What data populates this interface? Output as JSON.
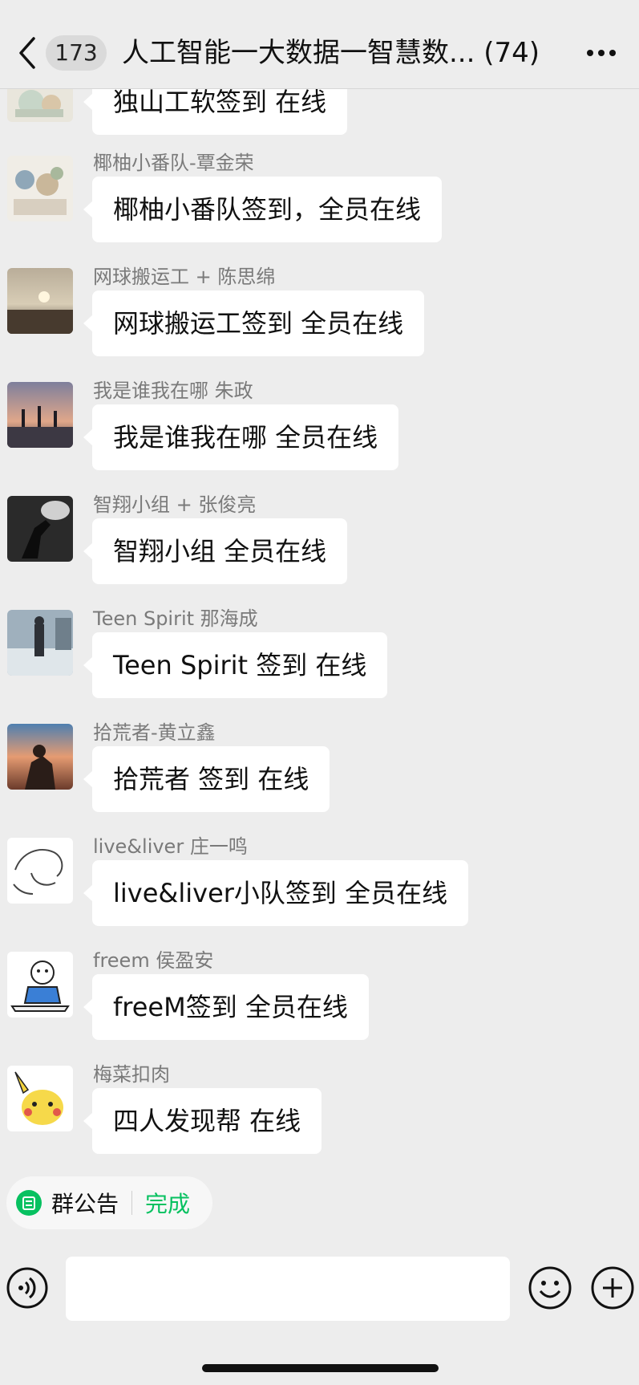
{
  "header": {
    "unread_count": "173",
    "title": "人工智能一大数据一智慧数... (74)"
  },
  "messages": [
    {
      "sender": "",
      "text": "独山工软签到  在线",
      "avatar_icon": "anime-figure-avatar"
    },
    {
      "sender": "椰柚小番队-覃金荣",
      "text": "椰柚小番队签到，全员在线",
      "avatar_icon": "anime-group-avatar"
    },
    {
      "sender": "网球搬运工 + 陈思绵",
      "text": "网球搬运工签到 全员在线",
      "avatar_icon": "sunset-beach-avatar"
    },
    {
      "sender": "我是谁我在哪 朱政",
      "text": "我是谁我在哪 全员在线",
      "avatar_icon": "silhouettes-sunset-avatar"
    },
    {
      "sender": "智翔小组 + 张俊亮",
      "text": "智翔小组 全员在线",
      "avatar_icon": "hand-shadow-avatar"
    },
    {
      "sender": "Teen Spirit 那海成",
      "text": "Teen Spirit 签到 在线",
      "avatar_icon": "street-walker-avatar"
    },
    {
      "sender": "拾荒者-黄立鑫",
      "text": "拾荒者 签到 在线",
      "avatar_icon": "sunset-sky-person-avatar"
    },
    {
      "sender": "live&liver 庄一鸣",
      "text": "live&liver小队签到 全员在线",
      "avatar_icon": "line-sketch-avatar"
    },
    {
      "sender": "freem 侯盈安",
      "text": "freeM签到 全员在线",
      "avatar_icon": "cartoon-reader-avatar"
    },
    {
      "sender": "梅菜扣肉",
      "text": "四人发现帮 在线",
      "avatar_icon": "pikachu-avatar"
    }
  ],
  "notice": {
    "label": "群公告",
    "status": "完成",
    "status_color": "#07c160"
  },
  "input": {
    "placeholder": ""
  },
  "colors": {
    "background": "#ededed",
    "bubble": "#ffffff",
    "sender_name": "#7a7a7a",
    "accent_green": "#07c160"
  }
}
